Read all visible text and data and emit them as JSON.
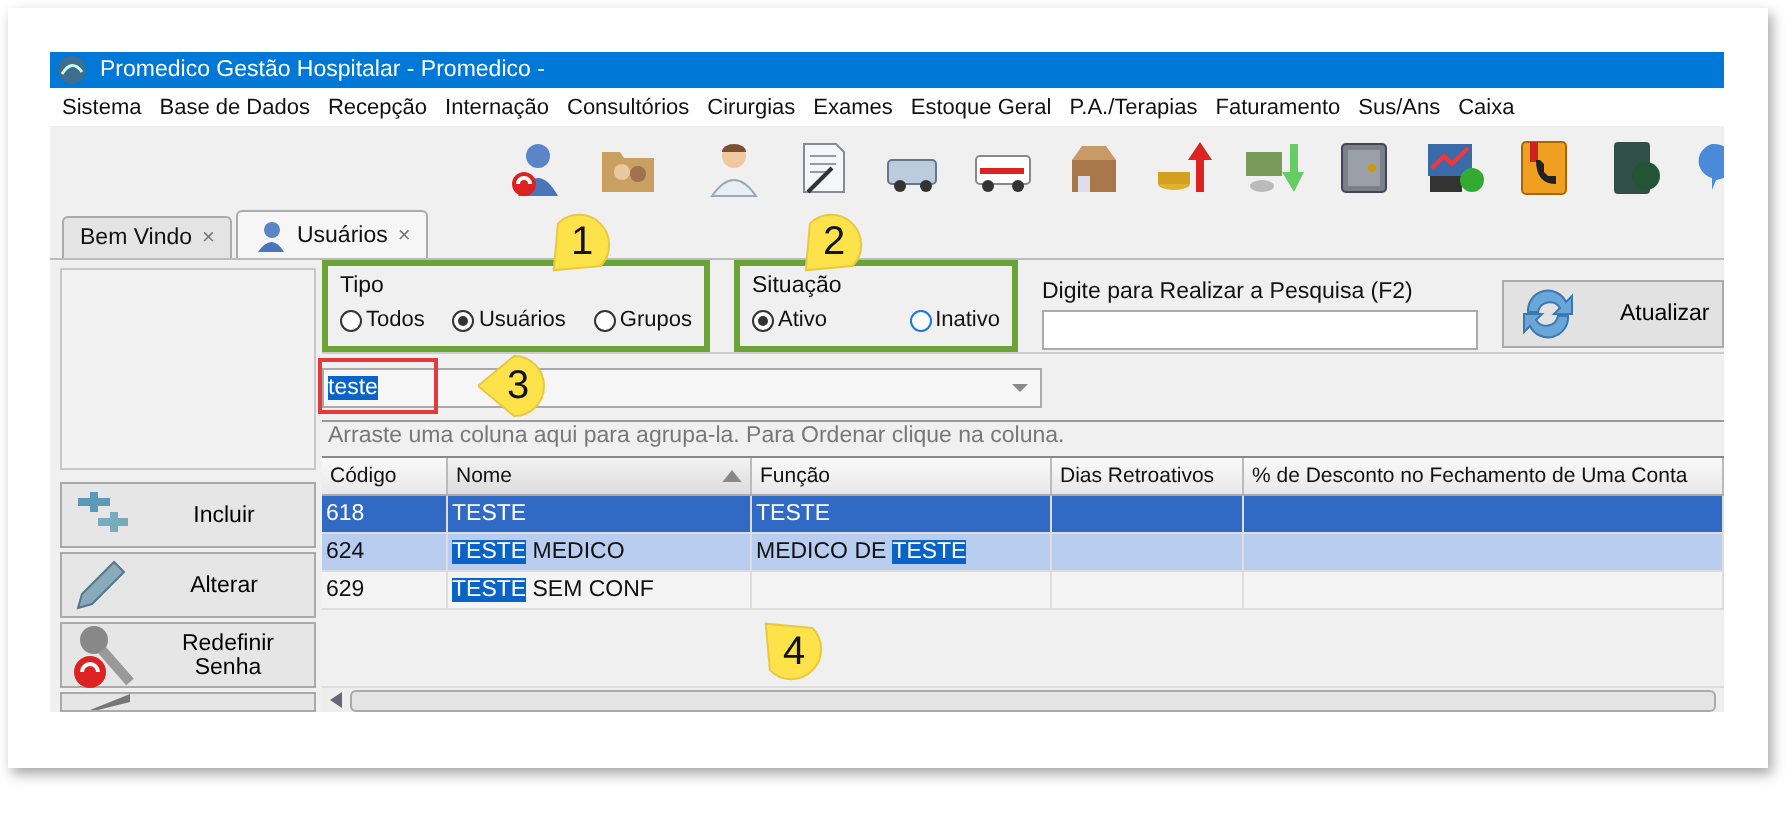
{
  "window": {
    "title": "Promedico Gestão Hospitalar - Promedico -"
  },
  "menu": [
    "Sistema",
    "Base de Dados",
    "Recepção",
    "Internação",
    "Consultórios",
    "Cirurgias",
    "Exames",
    "Estoque Geral",
    "P.A./Terapias",
    "Faturamento",
    "Sus/Ans",
    "Caixa"
  ],
  "toolbar": [
    {
      "kind": "users"
    },
    {
      "kind": "folder"
    },
    {
      "kind": "doctor"
    },
    {
      "kind": "document"
    },
    {
      "kind": "vehicle"
    },
    {
      "kind": "ambulance"
    },
    {
      "kind": "box"
    },
    {
      "kind": "coins-up"
    },
    {
      "kind": "money-down"
    },
    {
      "kind": "safe"
    },
    {
      "kind": "chart"
    },
    {
      "kind": "phonebook"
    },
    {
      "kind": "book"
    },
    {
      "kind": "bubble"
    }
  ],
  "tabs": [
    {
      "label": "Bem Vindo",
      "close": "×",
      "selected": false,
      "icon": false
    },
    {
      "label": "Usuários",
      "close": "×",
      "selected": true,
      "icon": true
    }
  ],
  "side_buttons": [
    {
      "label": "Incluir",
      "kind": "add"
    },
    {
      "label": "Alterar",
      "kind": "edit"
    },
    {
      "label": "Redefinir Senha",
      "kind": "reset"
    },
    {
      "kind": "settings"
    }
  ],
  "tipo": {
    "title": "Tipo",
    "annotated": true,
    "options": [
      {
        "label": "Todos",
        "selected": false
      },
      {
        "label": "Usuários",
        "selected": true
      },
      {
        "label": "Grupos",
        "selected": false
      }
    ]
  },
  "situacao": {
    "title": "Situação",
    "annotated": true,
    "options": [
      {
        "label": "Ativo",
        "selected": true
      },
      {
        "label": "Inativo",
        "selected": false
      }
    ]
  },
  "search": {
    "label": "Digite para Realizar a Pesquisa (F2)"
  },
  "refresh_button": {
    "label": "Atualizar"
  },
  "filter": {
    "value": "teste",
    "annotated": true
  },
  "group_hint": "Arraste uma coluna aqui para agrupa-la. Para Ordenar clique na coluna.",
  "table": {
    "columns": [
      {
        "label": "Código",
        "sorted": false
      },
      {
        "label": "Nome",
        "sorted": true
      },
      {
        "label": "Função",
        "sorted": false
      },
      {
        "label": "Dias Retroativos",
        "sorted": false
      },
      {
        "label": "% de Desconto no Fechamento de Uma Conta",
        "sorted": false
      }
    ],
    "rows": [
      {
        "selected": true,
        "highlighted": false,
        "cells": [
          [
            {
              "text": "618",
              "match": false
            }
          ],
          [
            {
              "text": "TESTE",
              "match": false
            }
          ],
          [
            {
              "text": "TESTE",
              "match": false
            }
          ],
          [],
          []
        ]
      },
      {
        "selected": false,
        "highlighted": true,
        "cells": [
          [
            {
              "text": "624",
              "match": false
            }
          ],
          [
            {
              "text": "TESTE",
              "match": true
            },
            {
              "text": " MEDICO",
              "match": false
            }
          ],
          [
            {
              "text": "MEDICO DE ",
              "match": false
            },
            {
              "text": "TESTE",
              "match": true
            }
          ],
          [],
          []
        ]
      },
      {
        "selected": false,
        "highlighted": false,
        "cells": [
          [
            {
              "text": "629",
              "match": false
            }
          ],
          [
            {
              "text": "TESTE",
              "match": true
            },
            {
              "text": " SEM CONF",
              "match": false
            }
          ],
          [],
          [],
          []
        ]
      }
    ]
  },
  "callouts": [
    {
      "label": "1"
    },
    {
      "label": "2"
    },
    {
      "label": "3"
    },
    {
      "label": "4"
    }
  ]
}
